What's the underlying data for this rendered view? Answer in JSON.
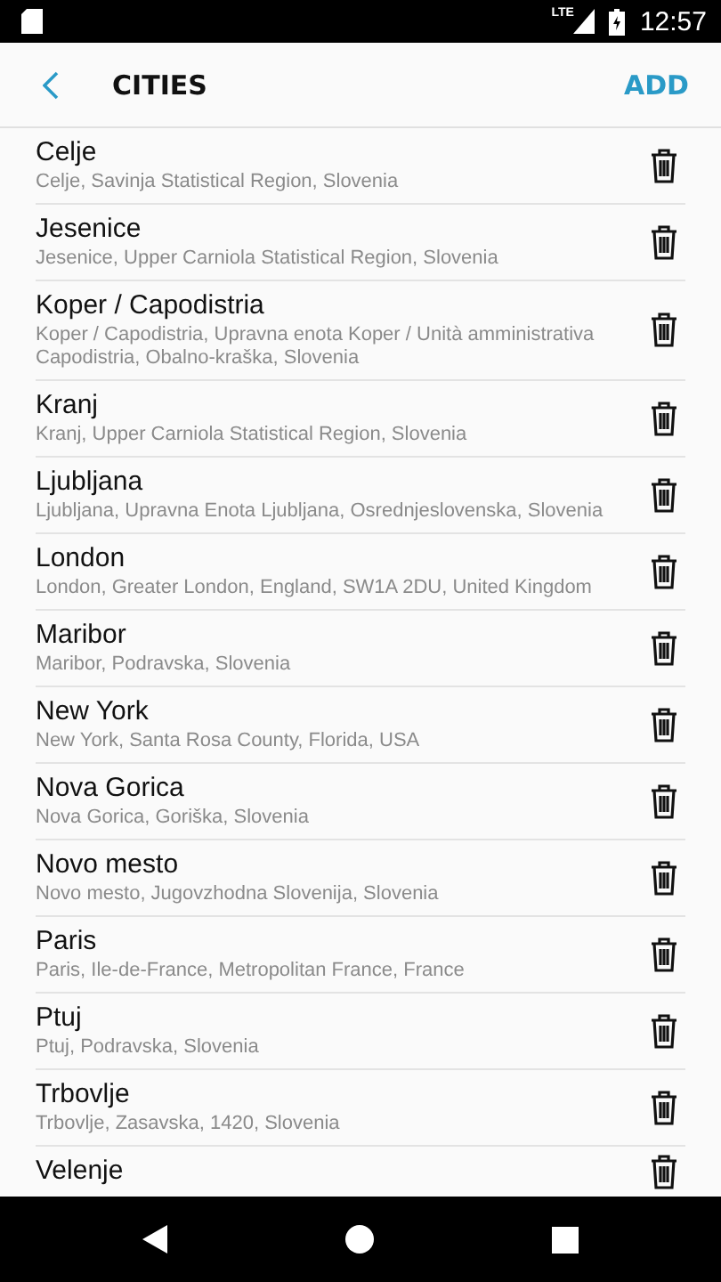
{
  "status_bar": {
    "network": "LTE",
    "time": "12:57"
  },
  "app_bar": {
    "title": "CITIES",
    "action": "ADD"
  },
  "cities": [
    {
      "name": "Celje",
      "detail": "Celje, Savinja Statistical Region, Slovenia"
    },
    {
      "name": "Jesenice",
      "detail": "Jesenice, Upper Carniola Statistical Region, Slovenia"
    },
    {
      "name": "Koper / Capodistria",
      "detail": "Koper / Capodistria, Upravna enota Koper / Unità amministrativa Capodistria, Obalno-kraška, Slovenia"
    },
    {
      "name": "Kranj",
      "detail": "Kranj, Upper Carniola Statistical Region, Slovenia"
    },
    {
      "name": "Ljubljana",
      "detail": "Ljubljana, Upravna Enota Ljubljana, Osrednjeslovenska, Slovenia"
    },
    {
      "name": "London",
      "detail": "London, Greater London, England, SW1A 2DU, United Kingdom"
    },
    {
      "name": "Maribor",
      "detail": "Maribor, Podravska, Slovenia"
    },
    {
      "name": "New York",
      "detail": "New York, Santa Rosa County, Florida, USA"
    },
    {
      "name": "Nova Gorica",
      "detail": "Nova Gorica, Goriška, Slovenia"
    },
    {
      "name": "Novo mesto",
      "detail": "Novo mesto, Jugovzhodna Slovenija, Slovenia"
    },
    {
      "name": "Paris",
      "detail": "Paris, Ile-de-France, Metropolitan France, France"
    },
    {
      "name": "Ptuj",
      "detail": "Ptuj, Podravska, Slovenia"
    },
    {
      "name": "Trbovlje",
      "detail": "Trbovlje, Zasavska, 1420, Slovenia"
    },
    {
      "name": "Velenje"
    }
  ]
}
